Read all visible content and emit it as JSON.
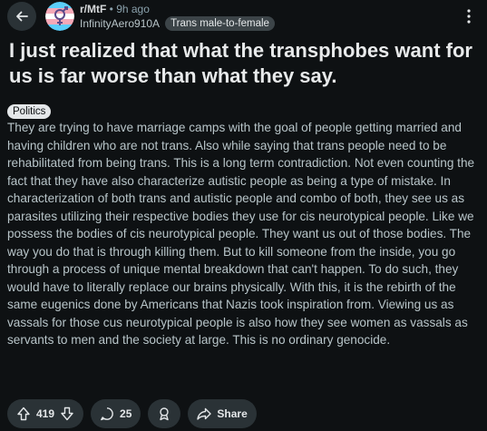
{
  "header": {
    "subreddit": "r/MtF",
    "time": " • 9h ago",
    "username": "InfinityAero910A",
    "user_flair": "Trans male-to-female"
  },
  "post": {
    "title": "I just realized that what the transphobes want for us is far worse than what they say.",
    "flair": "Politics",
    "body": "They are trying to have marriage camps with the goal of people getting married and having children who are not trans. Also while saying that trans people need to be rehabilitated from being trans. This is a long term contradiction. Not even counting the fact that they have also characterize autistic people as being a type of mistake. In characterization of both trans and autistic people and combo of both, they see us as parasites utilizing their respective bodies they use for cis neurotypical people. Like we possess the bodies of cis neurotypical people. They want us out of those bodies. The way you do that is through killing them. But to kill someone from the inside, you go through a process of unique mental breakdown that can't happen. To do such, they would have to literally replace our brains physically. With this, it is the rebirth of the same eugenics done by Americans that Nazis took inspiration from. Viewing us as vassals for those cus neurotypical people is also how they see women as vassals as servants to men and the society at large. This is no ordinary genocide."
  },
  "actions": {
    "votes": "419",
    "comments": "25",
    "share_label": "Share"
  },
  "icons": {
    "back": "arrow-left-icon",
    "avatar": "trans-flag-avatar",
    "more": "more-vertical-icon",
    "upvote": "arrow-up-icon",
    "downvote": "arrow-down-icon",
    "comment": "comment-bubble-icon",
    "award": "award-icon",
    "share": "share-arrow-icon"
  },
  "colors": {
    "background": "#0e1113",
    "button_bg": "#2a3236",
    "flag_blue": "#5bcefa",
    "flag_pink": "#f5a9b8",
    "flag_white": "#ffffff"
  }
}
